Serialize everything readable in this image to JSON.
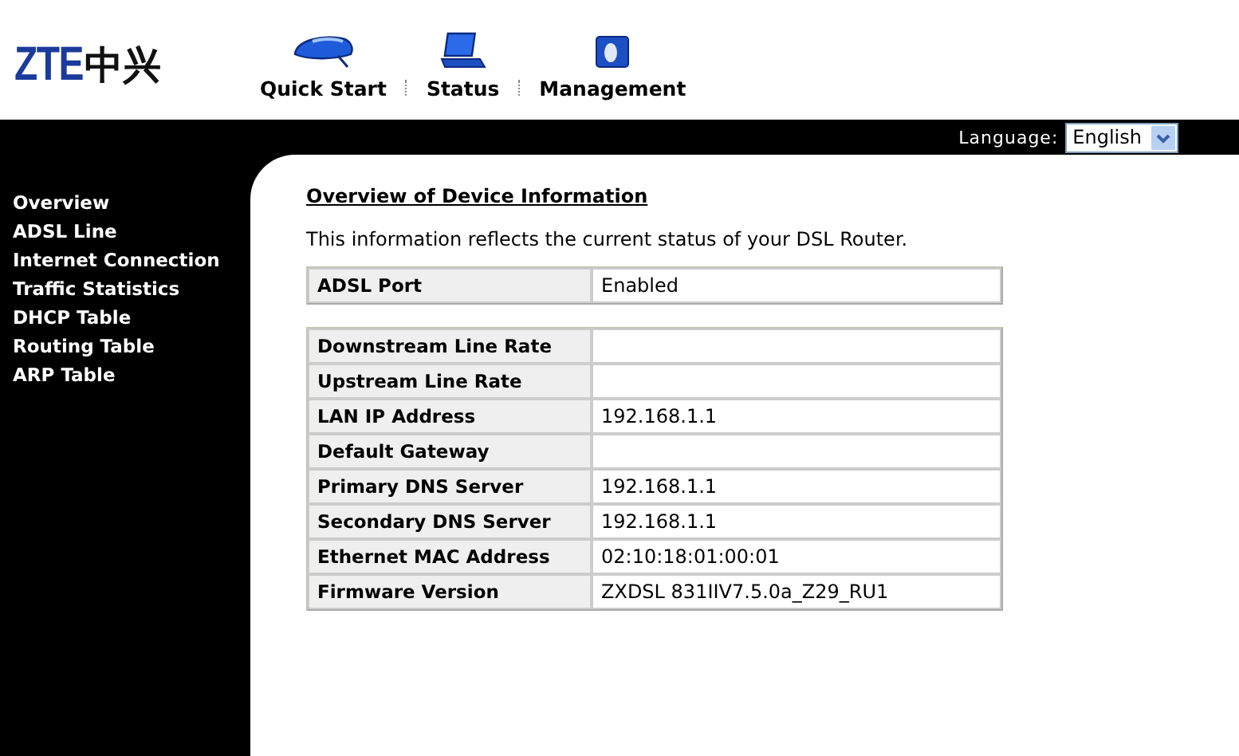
{
  "logo": {
    "latin": "ZTE",
    "chinese": "中兴"
  },
  "nav": [
    {
      "label": "Quick Start",
      "kind": "mouse"
    },
    {
      "label": "Status",
      "kind": "laptop"
    },
    {
      "label": "Management",
      "kind": "disk"
    }
  ],
  "language": {
    "label": "Language:",
    "value": "English"
  },
  "sidebar": {
    "items": [
      {
        "label": "Overview"
      },
      {
        "label": "ADSL Line"
      },
      {
        "label": "Internet Connection"
      },
      {
        "label": "Traffic Statistics"
      },
      {
        "label": "DHCP Table"
      },
      {
        "label": "Routing Table"
      },
      {
        "label": "ARP Table"
      }
    ]
  },
  "page": {
    "title": "Overview of Device Information",
    "intro": "This information reflects the current status of your DSL Router."
  },
  "tables": [
    {
      "rows": [
        {
          "label": "ADSL Port",
          "value": "Enabled"
        }
      ]
    },
    {
      "rows": [
        {
          "label": "Downstream Line Rate"
        },
        {
          "label": "Upstream Line Rate"
        },
        {
          "label": "LAN IP Address",
          "value": "192.168.1.1"
        },
        {
          "label": "Default Gateway"
        },
        {
          "label": "Primary DNS Server",
          "value": "192.168.1.1"
        },
        {
          "label": "Secondary DNS Server",
          "value": "192.168.1.1"
        },
        {
          "label": "Ethernet MAC Address",
          "value": "02:10:18:01:00:01"
        },
        {
          "label": "Firmware Version",
          "value": "ZXDSL 831IIV7.5.0a_Z29_RU1"
        }
      ]
    }
  ]
}
